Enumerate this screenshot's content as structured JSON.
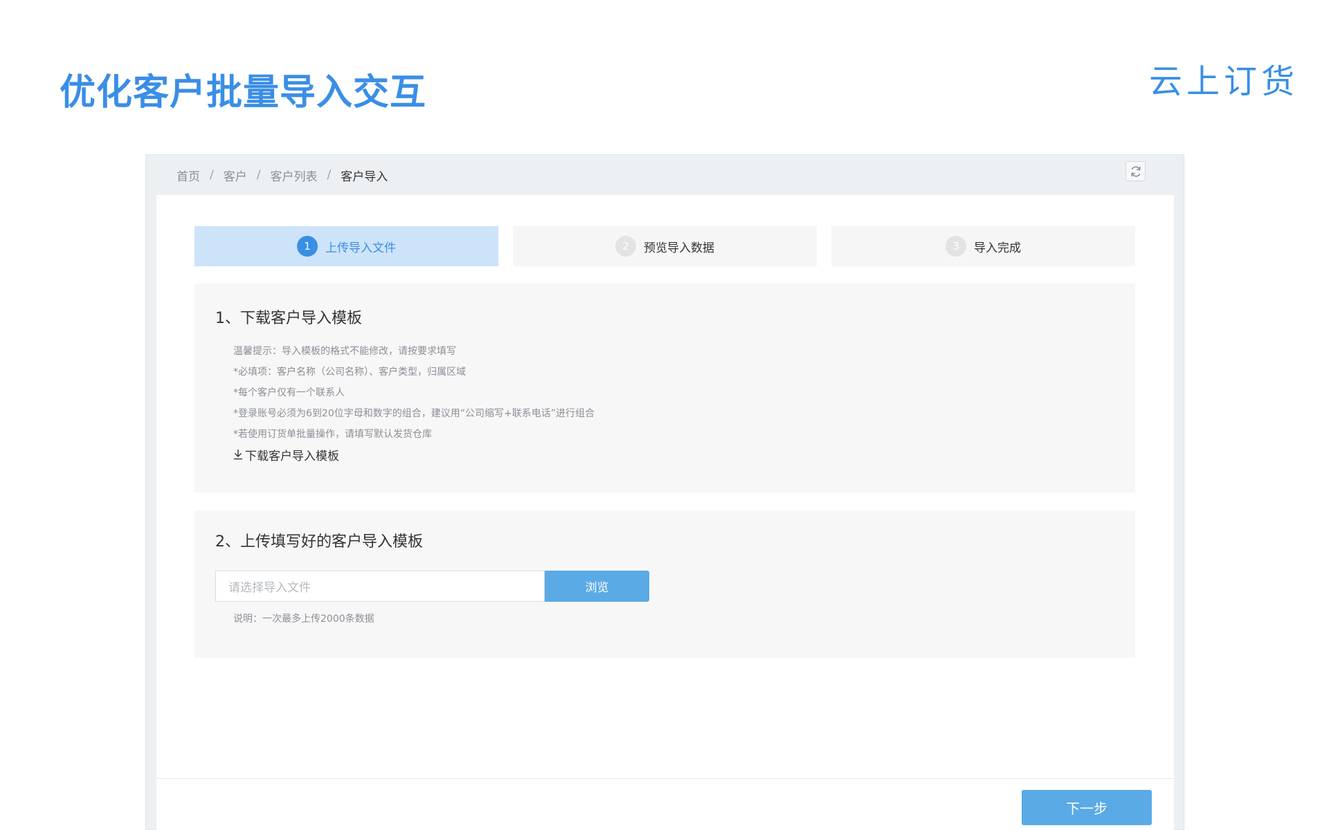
{
  "slide": {
    "title": "优化客户批量导入交互",
    "brand": "云上订货"
  },
  "breadcrumb": {
    "items": [
      "首页",
      "客户",
      "客户列表"
    ],
    "separator": "/",
    "current": "客户导入"
  },
  "toolbar": {
    "refresh_icon": "refresh-icon"
  },
  "steps": [
    {
      "num": "1",
      "label": "上传导入文件",
      "active": true
    },
    {
      "num": "2",
      "label": "预览导入数据",
      "active": false
    },
    {
      "num": "3",
      "label": "导入完成",
      "active": false
    }
  ],
  "section1": {
    "title": "1、下载客户导入模板",
    "tips": [
      "温馨提示：导入模板的格式不能修改，请按要求填写",
      "*必填项：客户名称（公司名称）、客户类型，归属区域",
      "*每个客户仅有一个联系人",
      "*登录账号必须为6到20位字母和数字的组合，建议用“公司缩写+联系电话”进行组合",
      "*若使用订货单批量操作，请填写默认发货仓库"
    ],
    "download_label": "下载客户导入模板",
    "download_icon": "download-icon"
  },
  "section2": {
    "title": "2、上传填写好的客户导入模板",
    "file_placeholder": "请选择导入文件",
    "browse_label": "浏览",
    "note": "说明：一次最多上传2000条数据"
  },
  "footer": {
    "next_label": "下一步"
  },
  "colors": {
    "accent": "#3a8ee6",
    "button": "#5aaae6",
    "active_step_bg": "#cde3fa"
  }
}
